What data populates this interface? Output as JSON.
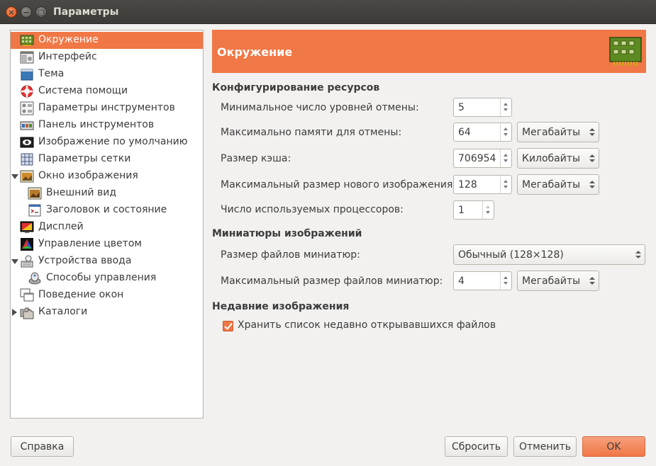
{
  "window": {
    "title": "Параметры"
  },
  "sidebar": {
    "items": [
      {
        "label": "Окружение",
        "icon": "environment-icon",
        "selected": true
      },
      {
        "label": "Интерфейс",
        "icon": "interface-icon"
      },
      {
        "label": "Тема",
        "icon": "theme-icon"
      },
      {
        "label": "Система помощи",
        "icon": "help-system-icon"
      },
      {
        "label": "Параметры инструментов",
        "icon": "tool-options-icon"
      },
      {
        "label": "Панель инструментов",
        "icon": "toolbox-icon"
      },
      {
        "label": "Изображение по умолчанию",
        "icon": "default-image-icon"
      },
      {
        "label": "Параметры сетки",
        "icon": "grid-icon"
      },
      {
        "label": "Окно изображения",
        "icon": "image-window-icon",
        "expanded": true
      },
      {
        "label": "Внешний вид",
        "icon": "appearance-icon",
        "child": true
      },
      {
        "label": "Заголовок и состояние",
        "icon": "title-status-icon",
        "child": true
      },
      {
        "label": "Дисплей",
        "icon": "display-icon"
      },
      {
        "label": "Управление цветом",
        "icon": "color-management-icon"
      },
      {
        "label": "Устройства ввода",
        "icon": "input-devices-icon",
        "expanded": true
      },
      {
        "label": "Способы управления",
        "icon": "input-controllers-icon",
        "child": true
      },
      {
        "label": "Поведение окон",
        "icon": "window-management-icon"
      },
      {
        "label": "Каталоги",
        "icon": "folders-icon",
        "collapsed": true
      }
    ]
  },
  "main": {
    "header_title": "Окружение",
    "resources": {
      "title": "Конфигурирование ресурсов",
      "undo_levels_label": "Минимальное число уровней отмены:",
      "undo_levels_value": "5",
      "undo_memory_label": "Максимально памяти для отмены:",
      "undo_memory_value": "64",
      "undo_memory_unit": "Мегабайты",
      "cache_label": "Размер кэша:",
      "cache_value": "706954",
      "cache_unit": "Килобайты",
      "max_image_label": "Максимальный размер нового изображения:",
      "max_image_value": "128",
      "max_image_unit": "Мегабайты",
      "processors_label": "Число используемых процессоров:",
      "processors_value": "1"
    },
    "thumbnails": {
      "title": "Миниатюры изображений",
      "size_label": "Размер файлов миниатюр:",
      "size_value": "Обычный (128×128)",
      "max_size_label": "Максимальный размер файлов миниатюр:",
      "max_size_value": "4",
      "max_size_unit": "Мегабайты"
    },
    "recent": {
      "title": "Недавние изображения",
      "keep_label": "Хранить список недавно открывавшихся файлов",
      "keep_checked": true
    }
  },
  "buttons": {
    "help": "Справка",
    "reset": "Сбросить",
    "cancel": "Отменить",
    "ok": "OK"
  },
  "colors": {
    "accent": "#f07746",
    "titlebar": "#3c3b37",
    "background": "#f2f1f0"
  }
}
